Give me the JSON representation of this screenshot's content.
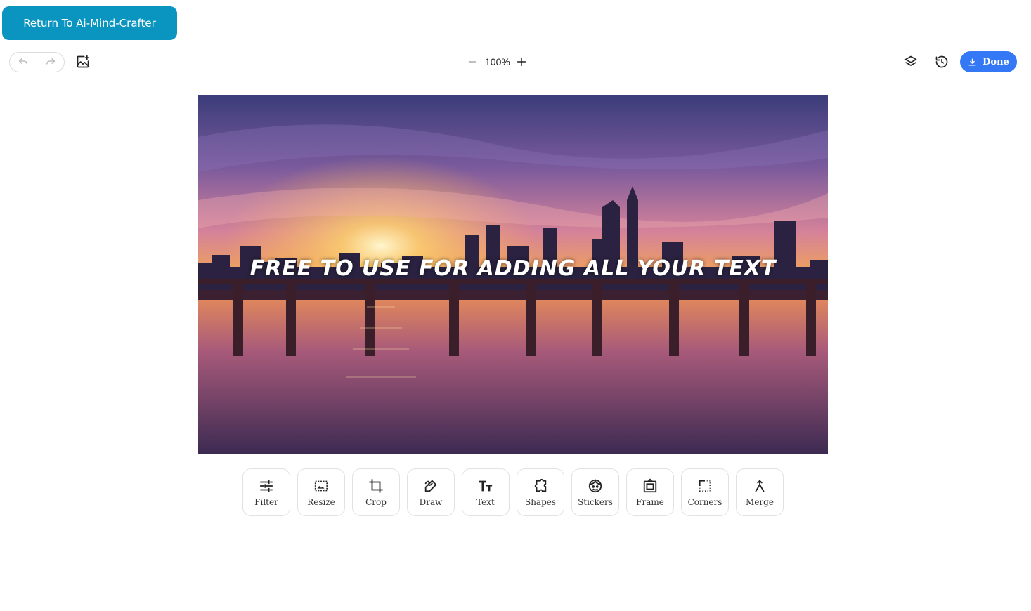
{
  "header": {
    "return_label": "Return To Ai-Mind-Crafter"
  },
  "top_bar": {
    "zoom_value": "100%",
    "done_label": "Done",
    "icons": [
      "undo-icon",
      "redo-icon",
      "add-image-icon",
      "zoom-out-icon",
      "zoom-in-icon",
      "layers-icon",
      "history-icon",
      "download-icon"
    ]
  },
  "canvas": {
    "overlay_text": "FREE TO USE FOR ADDING ALL YOUR TEXT"
  },
  "tools": [
    {
      "label": "Filter",
      "icon": "filter-icon"
    },
    {
      "label": "Resize",
      "icon": "resize-icon"
    },
    {
      "label": "Crop",
      "icon": "crop-icon"
    },
    {
      "label": "Draw",
      "icon": "draw-icon"
    },
    {
      "label": "Text",
      "icon": "text-icon"
    },
    {
      "label": "Shapes",
      "icon": "shapes-icon"
    },
    {
      "label": "Stickers",
      "icon": "stickers-icon"
    },
    {
      "label": "Frame",
      "icon": "frame-icon"
    },
    {
      "label": "Corners",
      "icon": "corners-icon"
    },
    {
      "label": "Merge",
      "icon": "merge-icon"
    }
  ],
  "colors": {
    "return_button": "#0a95c0",
    "done_button": "#3478f6"
  }
}
